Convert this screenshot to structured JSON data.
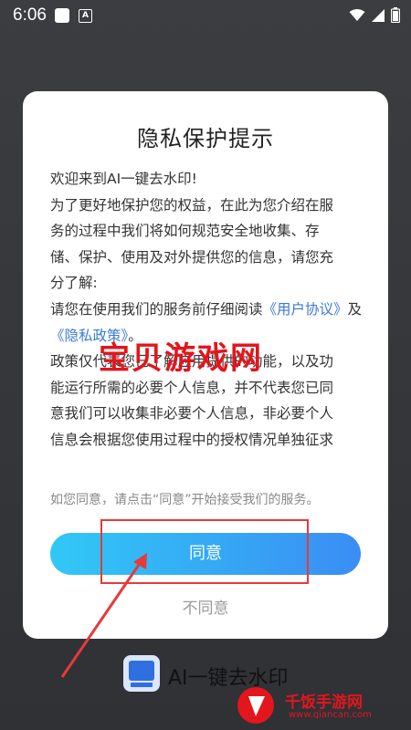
{
  "status_bar": {
    "time": "6:06"
  },
  "dialog": {
    "title": "隐私保护提示",
    "lines": [
      "欢迎来到AI一键去水印!",
      "为了更好地保护您的权益，在此为您介绍在服",
      "务的过程中我们将如何规范安全地收集、存",
      "储、保护、使用及对外提供您的信息，请您充",
      "分了解:"
    ],
    "policy_prefix": "请您在使用我们的服务前仔细阅读",
    "user_agreement_link": "《用户协议》",
    "and_text": "及",
    "privacy_policy_link": "《隐私政策》",
    "policy_suffix": "。",
    "after_lines": [
      "政策仅代表您已了解应用提供的功能，以及功",
      "能运行所需的必要个人信息，并不代表您已同",
      "意我们可以收集非必要个人信息，非必要个人",
      "信息会根据您使用过程中的授权情况单独征求"
    ],
    "consent_text": "如您同意，请点击“同意”开始接受我们的服务。",
    "agree_label": "同意",
    "disagree_label": "不同意"
  },
  "watermark": "宝贝游戏网",
  "app_name": "AI一键去水印",
  "corner_watermark": "千饭手游网",
  "corner_watermark_url": "www.qiancan.com",
  "colors": {
    "accent": "#3a8df4",
    "link": "#3a79d8",
    "annotation": "#e53a3a"
  }
}
